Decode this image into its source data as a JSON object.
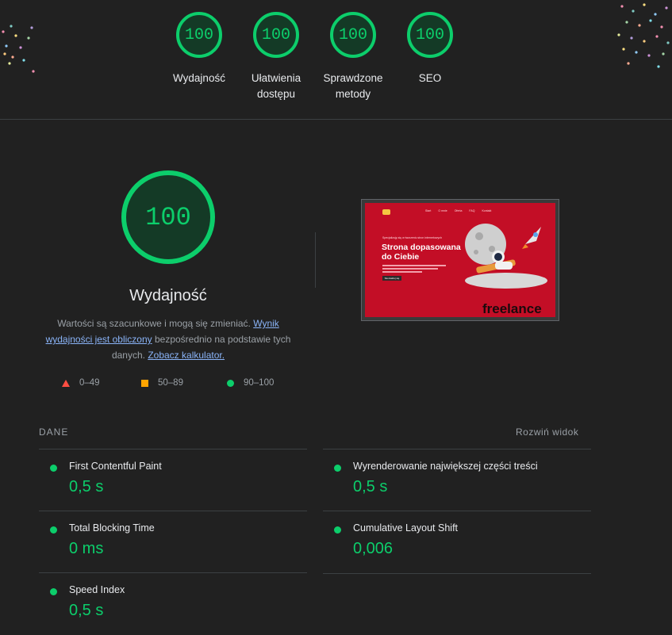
{
  "colors": {
    "pass": "#0cce6b",
    "average": "#ffa400",
    "fail": "#ff4e42",
    "background": "#212121"
  },
  "header_gauges": [
    {
      "score": "100",
      "label": "Wydajność"
    },
    {
      "score": "100",
      "label": "Ułatwienia dostępu"
    },
    {
      "score": "100",
      "label": "Sprawdzone metody"
    },
    {
      "score": "100",
      "label": "SEO"
    }
  ],
  "performance": {
    "score": "100",
    "title": "Wydajność",
    "desc_prefix": "Wartości są szacunkowe i mogą się zmieniać.",
    "desc_link1": "Wynik wydajności jest obliczony",
    "desc_mid": "bezpośrednio na podstawie tych danych.",
    "desc_link2": "Zobacz kalkulator."
  },
  "legend": [
    {
      "icon": "triangle-icon",
      "range": "0–49"
    },
    {
      "icon": "square-icon",
      "range": "50–89"
    },
    {
      "icon": "circle-icon",
      "range": "90–100"
    }
  ],
  "screenshot": {
    "nav_links": [
      "Start",
      "O mnie",
      "Oferta",
      "FAQ",
      "Kontakt"
    ],
    "kicker": "Specjalizuję się w tworzeniu stron internetowych",
    "headline_line1": "Strona dopasowana",
    "headline_line2": "do Ciebie",
    "cta": "Skontaktuj się",
    "watermark": "freelance"
  },
  "metrics": {
    "section_label": "DANE",
    "expand_label": "Rozwiń widok",
    "items": [
      {
        "name": "First Contentful Paint",
        "value": "0,5 s"
      },
      {
        "name": "Wyrenderowanie największej części treści",
        "value": "0,5 s"
      },
      {
        "name": "Total Blocking Time",
        "value": "0 ms"
      },
      {
        "name": "Cumulative Layout Shift",
        "value": "0,006"
      },
      {
        "name": "Speed Index",
        "value": "0,5 s"
      }
    ]
  }
}
